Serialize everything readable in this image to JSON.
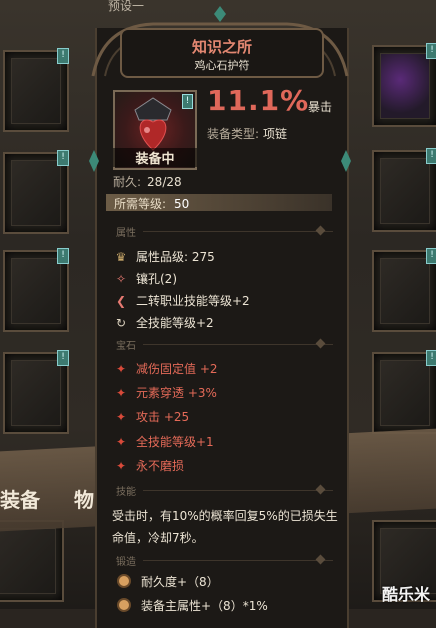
{
  "background": {
    "top_label": "预设一",
    "tabs": [
      "装备",
      "物品"
    ]
  },
  "tooltip": {
    "title": "知识之所",
    "subtitle": "鸡心石护符",
    "equip_status": "装备中",
    "main_value": "11.1%",
    "main_value_suffix": "暴击",
    "type_label": "装备类型:",
    "type_value": "项链",
    "durability_label": "耐久:",
    "durability_value": "28/28",
    "required_level_label": "所需等级:",
    "required_level_value": "50",
    "sections": {
      "attributes": "属性",
      "gems": "宝石",
      "skills": "技能",
      "forge": "锻造"
    },
    "attributes": [
      {
        "icon": "crown-icon",
        "text": "属性品级: 275"
      },
      {
        "icon": "socket-icon",
        "text": "镶孔(2)"
      },
      {
        "icon": "arrow-icon",
        "text": "二转职业技能等级+2"
      },
      {
        "icon": "cycle-icon",
        "text": "全技能等级+2"
      }
    ],
    "gems": [
      {
        "icon": "red-star-icon",
        "text": "减伤固定值 +2"
      },
      {
        "icon": "red-star-icon",
        "text": "元素穿透 +3%"
      },
      {
        "icon": "red-star-icon",
        "text": "攻击 +25"
      },
      {
        "icon": "red-star-icon",
        "text": "全技能等级+1"
      },
      {
        "icon": "red-star-icon",
        "text": "永不磨损"
      }
    ],
    "skill_desc": "受击时，有10%的概率回复5%的已损失生命值，冷却7秒。",
    "forge": [
      {
        "icon": "forge-dot-icon",
        "text": "耐久度+（8）"
      },
      {
        "icon": "forge-dot-icon",
        "text": "装备主属性+（8）*1%"
      }
    ]
  },
  "watermark": "酷乐米",
  "colors": {
    "accent_red": "#e0685a",
    "gem_red": "#e46a58",
    "frame": "#6e5a44"
  }
}
